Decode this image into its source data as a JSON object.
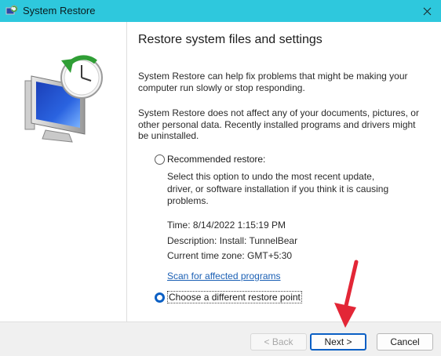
{
  "window": {
    "title": "System Restore"
  },
  "icons": {
    "app": "system-restore-icon",
    "close": "close-icon",
    "hero": "computer-clock-icon",
    "annotation": "red-arrow"
  },
  "colors": {
    "titlebar": "#2ec8dd",
    "accent": "#0a5fc4",
    "link": "#1a5fb4",
    "annotation": "#e32636"
  },
  "main": {
    "heading": "Restore system files and settings",
    "para1": "System Restore can help fix problems that might be making your computer run slowly or stop responding.",
    "para2": "System Restore does not affect any of your documents, pictures, or other personal data. Recently installed programs and drivers might be uninstalled.",
    "recommended_label": "Recommended restore:",
    "recommended_desc": "Select this option to undo the most recent update, driver, or software installation if you think it is causing problems.",
    "time": "Time: 8/14/2022 1:15:19 PM",
    "description": "Description: Install: TunnelBear",
    "timezone": "Current time zone: GMT+5:30",
    "scan_link": "Scan for affected programs",
    "different_label": "Choose a different restore point",
    "selected_option": "Choose a different restore point"
  },
  "buttons": {
    "back": "< Back",
    "next": "Next >",
    "cancel": "Cancel"
  }
}
